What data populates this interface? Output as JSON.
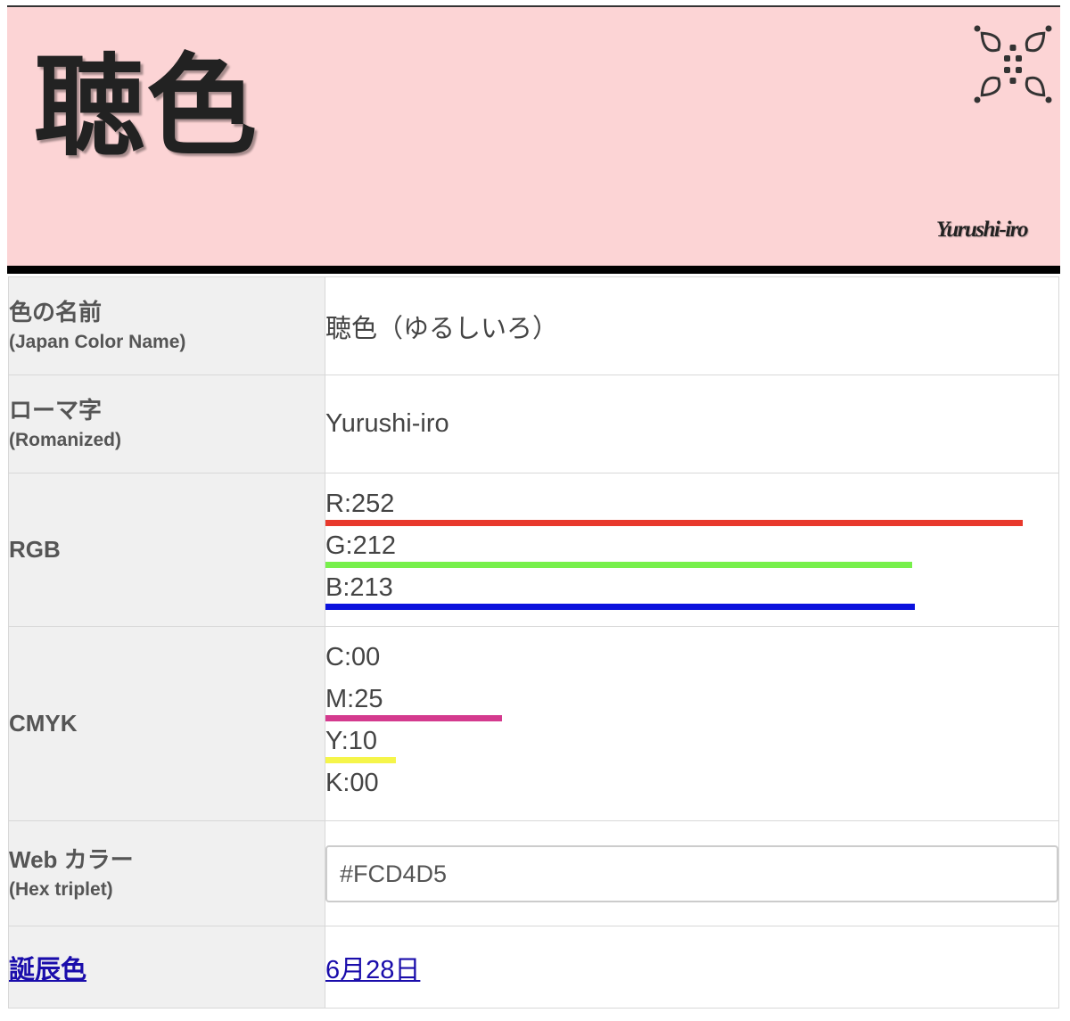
{
  "header": {
    "title": "聴色",
    "romanized": "Yurushi-iro",
    "background": "#FCD4D5",
    "crest_icon": "family-crest-icon"
  },
  "rows": {
    "name": {
      "label": "色の名前",
      "sublabel": "(Japan Color Name)",
      "value": "聴色（ゆるしいろ）"
    },
    "romanized": {
      "label": "ローマ字",
      "sublabel": "(Romanized)",
      "value": "Yurushi-iro"
    },
    "rgb": {
      "label": "RGB",
      "channels": [
        {
          "text": "R:252",
          "value": 252,
          "max": 255,
          "color": "#E8392C"
        },
        {
          "text": "G:212",
          "value": 212,
          "max": 255,
          "color": "#77F04B"
        },
        {
          "text": "B:213",
          "value": 213,
          "max": 255,
          "color": "#0B12DD"
        }
      ]
    },
    "cmyk": {
      "label": "CMYK",
      "channels": [
        {
          "text": "C:00",
          "value": 0,
          "max": 100,
          "color": "#00A0E9"
        },
        {
          "text": "M:25",
          "value": 25,
          "max": 100,
          "color": "#D43A8E"
        },
        {
          "text": "Y:10",
          "value": 10,
          "max": 100,
          "color": "#F5F54A"
        },
        {
          "text": "K:00",
          "value": 0,
          "max": 100,
          "color": "#222222"
        }
      ]
    },
    "web": {
      "label": "Web カラー",
      "sublabel": "(Hex triplet)",
      "value": "#FCD4D5"
    },
    "birthday": {
      "label": "誕辰色",
      "value": "6月28日"
    }
  }
}
